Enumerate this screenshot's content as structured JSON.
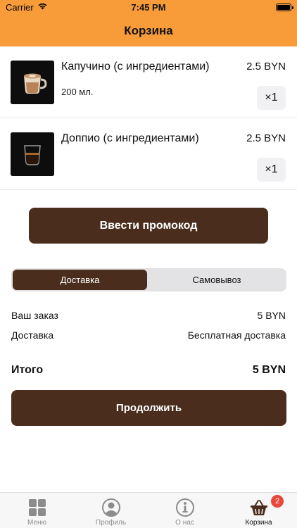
{
  "status_bar": {
    "carrier": "Carrier",
    "time": "7:45 PM"
  },
  "header": {
    "title": "Корзина",
    "color": "#f89c3a"
  },
  "cart": {
    "items": [
      {
        "name": "Капучино (с ингредиентами)",
        "volume": "200 мл.",
        "price": "2.5 BYN",
        "quantity": "×1",
        "icon": "cappuccino-cup-icon"
      },
      {
        "name": "Доппио (с ингредиентами)",
        "volume": "",
        "price": "2.5 BYN",
        "quantity": "×1",
        "icon": "doppio-glass-icon"
      }
    ]
  },
  "promo": {
    "label": "Ввести промокод"
  },
  "delivery_toggle": {
    "options": [
      "Доставка",
      "Самовывоз"
    ],
    "selected": "Доставка"
  },
  "summary": {
    "order_label": "Ваш заказ",
    "order_value": "5 BYN",
    "delivery_label": "Доставка",
    "delivery_value": "Бесплатная доставка",
    "total_label": "Итого",
    "total_value": "5 BYN"
  },
  "continue": {
    "label": "Продолжить"
  },
  "tabbar": {
    "tabs": [
      {
        "label": "Меню",
        "icon": "menu-grid-icon"
      },
      {
        "label": "Профиль",
        "icon": "profile-icon"
      },
      {
        "label": "О нас",
        "icon": "info-icon"
      },
      {
        "label": "Корзина",
        "icon": "basket-icon",
        "badge": "2",
        "active": true
      }
    ]
  },
  "colors": {
    "accent": "#4a2d1c",
    "header": "#f89c3a",
    "badge": "#e8483a"
  }
}
